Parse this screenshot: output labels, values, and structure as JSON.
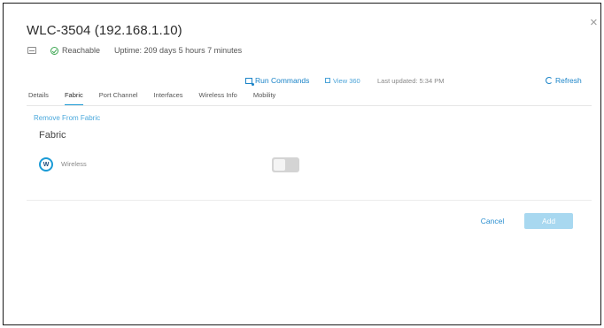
{
  "header": {
    "title": "WLC-3504 (192.168.1.10)",
    "close_icon": "×",
    "status": "Reachable",
    "uptime": "Uptime: 209 days 5 hours 7 minutes"
  },
  "toolbar": {
    "run_commands": "Run Commands",
    "view_360": "View 360",
    "last_updated": "Last updated: 5:34 PM",
    "refresh": "Refresh"
  },
  "tabs": [
    {
      "label": "Details",
      "active": false
    },
    {
      "label": "Fabric",
      "active": true
    },
    {
      "label": "Port Channel",
      "active": false
    },
    {
      "label": "Interfaces",
      "active": false
    },
    {
      "label": "Wireless Info",
      "active": false
    },
    {
      "label": "Mobility",
      "active": false
    }
  ],
  "fabric": {
    "remove_link": "Remove From Fabric",
    "section_title": "Fabric",
    "wireless_badge": "W",
    "wireless_label": "Wireless",
    "wireless_enabled": false
  },
  "footer": {
    "cancel": "Cancel",
    "add": "Add"
  },
  "colors": {
    "accent": "#1b9bd6",
    "link": "#4aa8dc",
    "reachable": "#3da652",
    "add_button_disabled": "#a8d8f0"
  }
}
